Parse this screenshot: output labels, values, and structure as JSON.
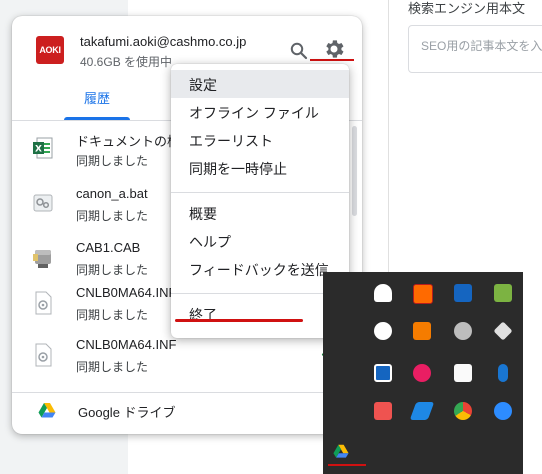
{
  "background": {
    "field_label": "検索エンジン用本文",
    "field_placeholder": "SEO用の記事本文を入"
  },
  "account": {
    "logo_text": "AOKI",
    "email": "takafumi.aoki@cashmo.co.jp",
    "usage": "40.6GB を使用中"
  },
  "tabs": [
    {
      "label": "履歴"
    }
  ],
  "files": [
    {
      "name": "ドキュメントの権",
      "status": "同期しました",
      "icon": "sheets-icon"
    },
    {
      "name": "canon_a.bat",
      "status": "同期しました",
      "icon": "batch-file-icon"
    },
    {
      "name": "CAB1.CAB",
      "status": "同期しました",
      "icon": "cab-file-icon"
    },
    {
      "name": "CNLB0MA64.INF",
      "status": "同期しました",
      "icon": "inf-file-icon"
    },
    {
      "name": "CNLB0MA64.INF",
      "status": "同期しました",
      "icon": "inf-file-icon",
      "checked": true
    }
  ],
  "footer": {
    "label": "Google ドライブ"
  },
  "menu": {
    "items": [
      {
        "label": "設定",
        "highlighted": true
      },
      {
        "label": "オフライン ファイル"
      },
      {
        "label": "エラーリスト"
      },
      {
        "label": "同期を一時停止"
      },
      {
        "label": "概要"
      },
      {
        "label": "ヘルプ"
      },
      {
        "label": "フィードバックを送信"
      },
      {
        "label": "終了"
      }
    ]
  },
  "colors": {
    "accent": "#1a73e8",
    "annotation_red": "#d01111",
    "check_green": "#188038"
  }
}
